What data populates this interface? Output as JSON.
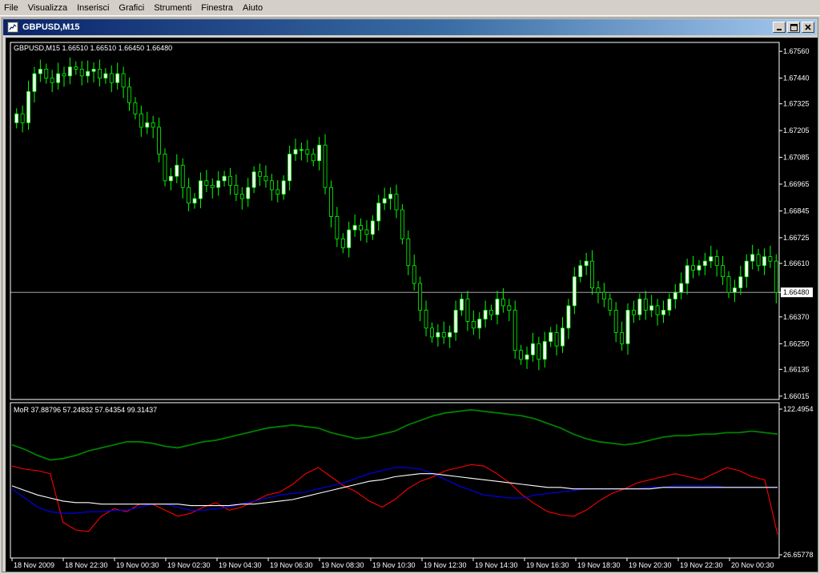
{
  "menubar": {
    "items": [
      {
        "label": "File"
      },
      {
        "label": "Visualizza"
      },
      {
        "label": "Inserisci"
      },
      {
        "label": "Grafici"
      },
      {
        "label": "Strumenti"
      },
      {
        "label": "Finestra"
      },
      {
        "label": "Aiuto"
      }
    ]
  },
  "window": {
    "title": "GBPUSD,M15",
    "icon": "chart-window-icon",
    "buttons": [
      "minimize-icon",
      "maximize-icon",
      "close-icon"
    ]
  },
  "colors": {
    "background": "#000000",
    "candle_up": "#ffffff",
    "candle_outline": "#00ff00",
    "grid": "#ffffff",
    "current_price_line": "#c0c0c0",
    "indicator_green": "#008000",
    "indicator_red": "#ff0000",
    "indicator_blue": "#0000ff",
    "indicator_white": "#ffffff"
  },
  "chart_data": [
    {
      "type": "candlestick",
      "header": "GBPUSD,M15  1.66510 1.66510 1.66450 1.66480",
      "y_ticks": [
        "1.67560",
        "1.67440",
        "1.67325",
        "1.67205",
        "1.67085",
        "1.66965",
        "1.66845",
        "1.66725",
        "1.66610",
        "1.66480",
        "1.66370",
        "1.66250",
        "1.66135",
        "1.66015"
      ],
      "current_price": "1.66480",
      "ylim": [
        1.66,
        1.676
      ],
      "closes": [
        1.6728,
        1.6724,
        1.6738,
        1.6746,
        1.6748,
        1.6744,
        1.6742,
        1.6746,
        1.6745,
        1.6749,
        1.6748,
        1.6745,
        1.6747,
        1.6748,
        1.6744,
        1.6746,
        1.6742,
        1.6746,
        1.674,
        1.6733,
        1.6728,
        1.6722,
        1.6724,
        1.6722,
        1.671,
        1.6698,
        1.67,
        1.6705,
        1.6695,
        1.6688,
        1.669,
        1.6698,
        1.6696,
        1.6695,
        1.6698,
        1.67,
        1.6696,
        1.6692,
        1.669,
        1.6695,
        1.6702,
        1.67,
        1.6698,
        1.6694,
        1.6692,
        1.6698,
        1.671,
        1.6712,
        1.6712,
        1.671,
        1.6707,
        1.6714,
        1.6695,
        1.6682,
        1.6672,
        1.6668,
        1.6676,
        1.6678,
        1.6676,
        1.6674,
        1.668,
        1.6688,
        1.669,
        1.6692,
        1.6685,
        1.6672,
        1.666,
        1.6652,
        1.664,
        1.6632,
        1.6628,
        1.663,
        1.6628,
        1.663,
        1.664,
        1.6645,
        1.6635,
        1.6632,
        1.6636,
        1.664,
        1.6638,
        1.6645,
        1.6642,
        1.664,
        1.6622,
        1.6618,
        1.662,
        1.6625,
        1.6618,
        1.6626,
        1.663,
        1.6624,
        1.6632,
        1.6642,
        1.6655,
        1.666,
        1.6662,
        1.665,
        1.6648,
        1.6645,
        1.664,
        1.663,
        1.6625,
        1.664,
        1.6638,
        1.6645,
        1.664,
        1.6642,
        1.6638,
        1.664,
        1.6645,
        1.6648,
        1.6652,
        1.666,
        1.6658,
        1.666,
        1.6662,
        1.6664,
        1.666,
        1.6655,
        1.6648,
        1.665,
        1.6655,
        1.6662,
        1.6665,
        1.666,
        1.6664,
        1.6662,
        1.6648
      ]
    },
    {
      "type": "line",
      "header": "MoR 37.88796 57.24832 57.64354 99.31437",
      "y_ticks": [
        "122.4954",
        "26.65778"
      ],
      "ylim": [
        26.65778,
        122.4954
      ],
      "x_labels": [
        "18 Nov 2009",
        "18 Nov 22:30",
        "19 Nov 00:30",
        "19 Nov 02:30",
        "19 Nov 04:30",
        "19 Nov 06:30",
        "19 Nov 08:30",
        "19 Nov 10:30",
        "19 Nov 12:30",
        "19 Nov 14:30",
        "19 Nov 16:30",
        "19 Nov 18:30",
        "19 Nov 20:30",
        "19 Nov 22:30",
        "20 Nov 00:30"
      ],
      "series": [
        {
          "color": "#008000",
          "values": [
            99,
            96,
            92,
            89,
            90,
            92,
            95,
            97,
            99,
            101,
            101,
            100,
            98,
            97,
            99,
            101,
            102,
            104,
            106,
            108,
            110,
            111,
            112,
            111,
            110,
            107,
            105,
            103,
            104,
            106,
            108,
            112,
            115,
            118,
            120,
            121,
            122,
            121,
            120,
            119,
            118,
            116,
            113,
            110,
            106,
            103,
            101,
            100,
            99,
            100,
            102,
            104,
            105,
            105,
            106,
            106,
            107,
            107,
            108,
            107,
            106
          ]
        },
        {
          "color": "#ff0000",
          "values": [
            85,
            83,
            82,
            80,
            48,
            43,
            42,
            52,
            57,
            55,
            60,
            60,
            56,
            52,
            54,
            58,
            61,
            56,
            58,
            62,
            66,
            68,
            73,
            80,
            84,
            78,
            72,
            68,
            62,
            58,
            63,
            70,
            75,
            78,
            82,
            84,
            86,
            85,
            80,
            74,
            66,
            60,
            55,
            53,
            52,
            56,
            62,
            67,
            70,
            74,
            76,
            78,
            80,
            78,
            76,
            80,
            84,
            82,
            78,
            76,
            40
          ]
        },
        {
          "color": "#0000ff",
          "values": [
            70,
            64,
            58,
            55,
            54,
            54,
            55,
            55,
            56,
            56,
            58,
            60,
            60,
            58,
            56,
            56,
            57,
            58,
            60,
            62,
            64,
            66,
            67,
            68,
            70,
            72,
            74,
            77,
            80,
            82,
            84,
            84,
            83,
            80,
            76,
            72,
            69,
            66,
            65,
            64,
            64,
            66,
            67,
            68,
            69,
            70,
            70,
            70,
            70,
            70,
            71,
            71,
            72,
            72,
            72,
            72,
            71,
            71,
            71,
            71,
            71
          ]
        },
        {
          "color": "#ffffff",
          "values": [
            72,
            69,
            66,
            64,
            62,
            61,
            61,
            60,
            60,
            60,
            60,
            60,
            60,
            60,
            59,
            59,
            59,
            59,
            60,
            60,
            61,
            62,
            63,
            65,
            67,
            69,
            71,
            73,
            75,
            76,
            78,
            79,
            80,
            80,
            79,
            78,
            77,
            76,
            75,
            74,
            73,
            72,
            71,
            71,
            70,
            70,
            70,
            70,
            70,
            70,
            70,
            71,
            71,
            71,
            71,
            71,
            71,
            71,
            71,
            71,
            71
          ]
        }
      ]
    }
  ]
}
